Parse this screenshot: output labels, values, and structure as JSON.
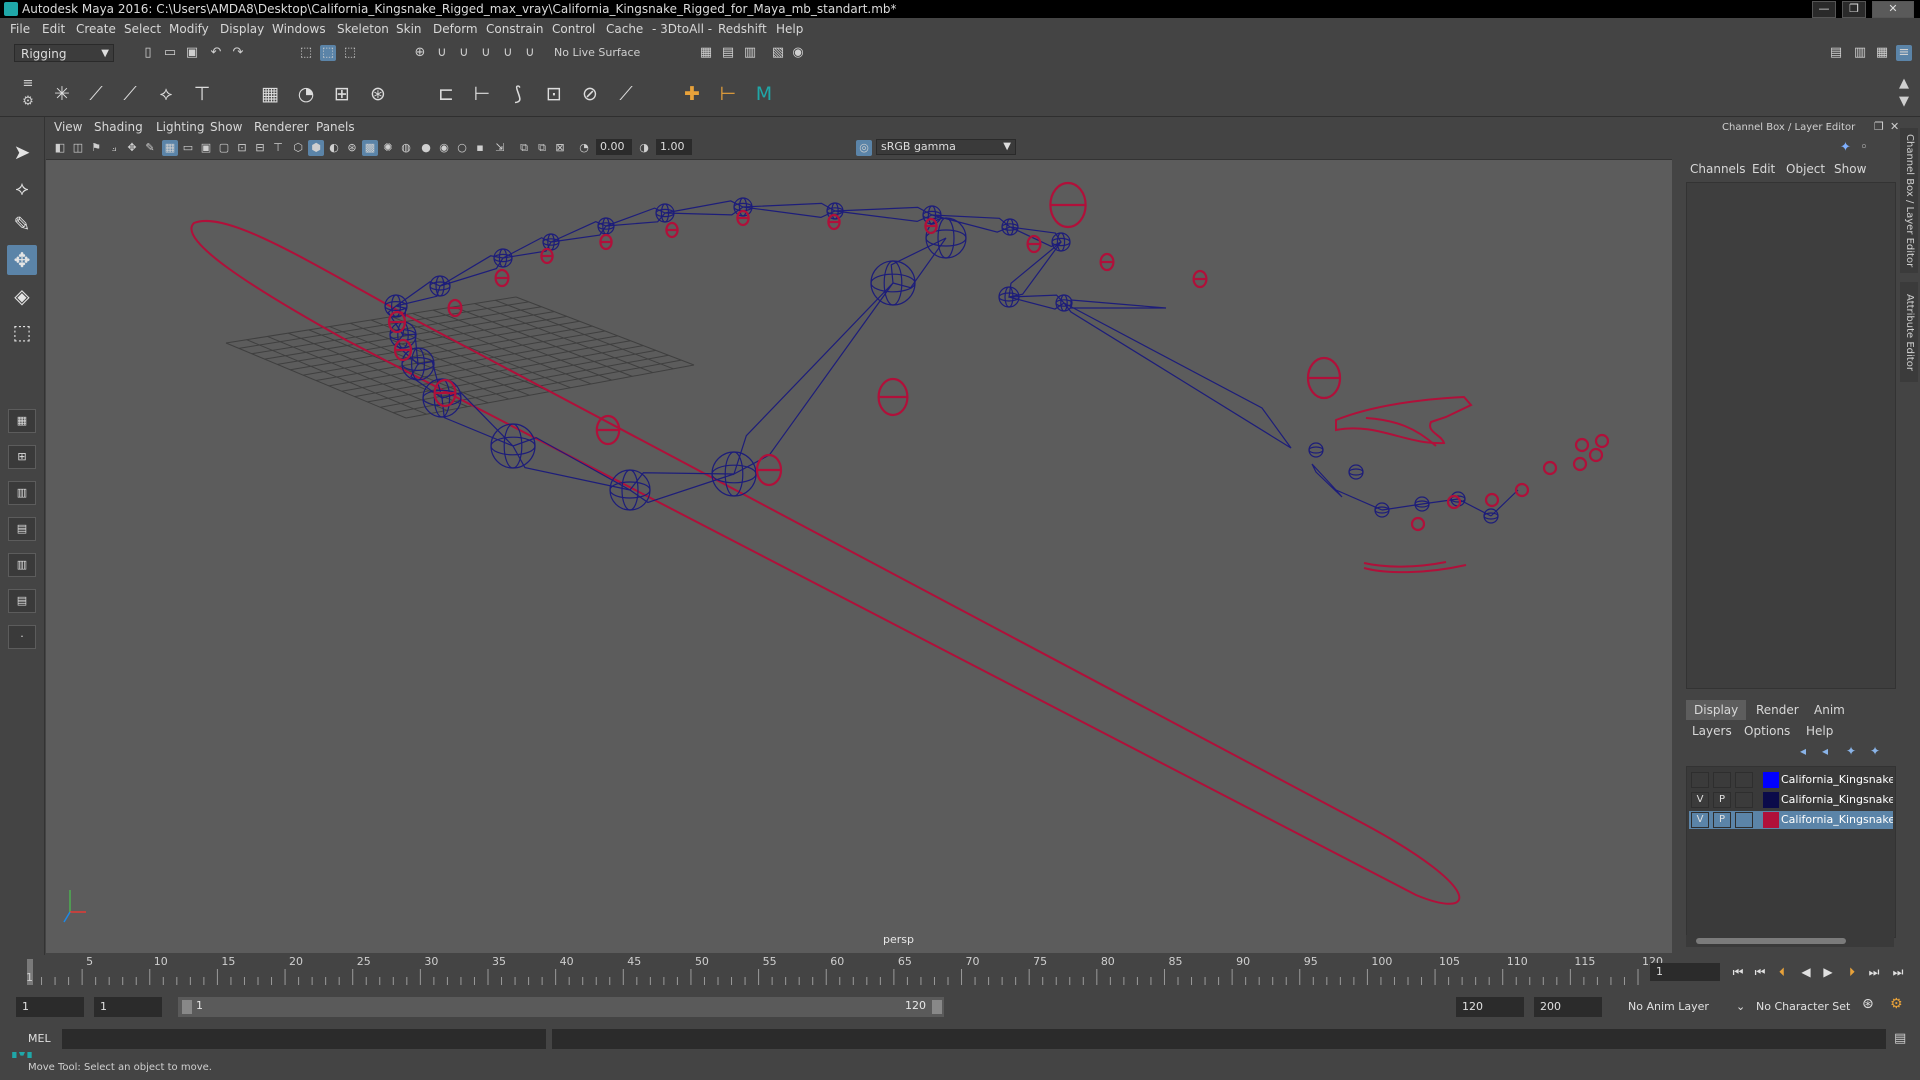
{
  "window": {
    "title": "Autodesk Maya 2016: C:\\Users\\AMDA8\\Desktop\\California_Kingsnake_Rigged_max_vray\\California_Kingsnake_Rigged_for_Maya_mb_standart.mb*",
    "minimize": "—",
    "maximize": "❐",
    "close": "✕"
  },
  "menubar": [
    "File",
    "Edit",
    "Create",
    "Select",
    "Modify",
    "Display",
    "Windows",
    "Skeleton",
    "Skin",
    "Deform",
    "Constrain",
    "Control",
    "Cache",
    "- 3DtoAll -",
    "Redshift",
    "Help"
  ],
  "status_line": {
    "mode": "Rigging",
    "live_surface": "No Live Surface"
  },
  "panel": {
    "menu": [
      "View",
      "Shading",
      "Lighting",
      "Show",
      "Renderer",
      "Panels"
    ],
    "exposure": "0.00",
    "gamma_value": "1.00",
    "color_space": "sRGB gamma",
    "camera_label": "persp"
  },
  "channel_box": {
    "header": "Channel Box / Layer Editor",
    "tabs": [
      "Channels",
      "Edit",
      "Object",
      "Show"
    ],
    "side_tabs": [
      "Channel Box / Layer Editor",
      "Attribute Editor"
    ]
  },
  "layer_editor": {
    "tabs": [
      "Display",
      "Render",
      "Anim"
    ],
    "active_tab": "Display",
    "menu": [
      "Layers",
      "Options",
      "Help"
    ],
    "layers": [
      {
        "v": "",
        "p": "",
        "color": "#0000ff",
        "name": "California_Kingsnake_",
        "selected": false
      },
      {
        "v": "V",
        "p": "P",
        "color": "#0b0b4a",
        "name": "California_Kingsnake_",
        "selected": false
      },
      {
        "v": "V",
        "p": "P",
        "color": "#b0103a",
        "name": "California_Kingsnake_",
        "selected": true
      }
    ]
  },
  "timeline": {
    "ticks": [
      "5",
      "10",
      "15",
      "20",
      "25",
      "30",
      "35",
      "40",
      "45",
      "50",
      "55",
      "60",
      "65",
      "70",
      "75",
      "80",
      "85",
      "90",
      "95",
      "100",
      "105",
      "110",
      "115",
      "120"
    ],
    "start_label": "1",
    "current_frame": "1"
  },
  "range": {
    "start": "1",
    "anim_start": "1",
    "slider_start": "1",
    "slider_end": "120",
    "end": "120",
    "anim_end": "200",
    "anim_layer": "No Anim Layer",
    "character_set": "No Character Set"
  },
  "command_line": {
    "lang": "MEL"
  },
  "help_line": "Move Tool: Select an object to move.",
  "colors": {
    "controller": "#b0103a",
    "joint": "#1d1d7a",
    "selection": "#5b84a8",
    "viewport": "#5c5c5c"
  }
}
